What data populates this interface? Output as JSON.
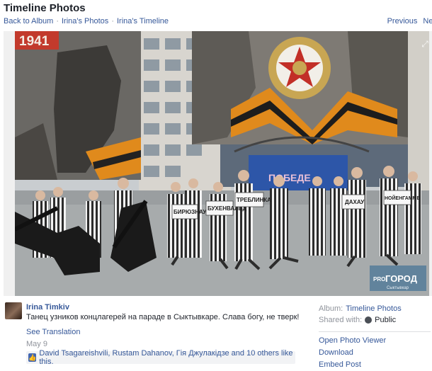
{
  "header": {
    "title": "Timeline Photos",
    "breadcrumbs": [
      "Back to Album",
      "Irina's Photos",
      "Irina's Timeline"
    ],
    "separator": "·",
    "prev_label": "Previous",
    "next_label": "Next"
  },
  "photo": {
    "year_text": "1941",
    "watermark_top": "PRO",
    "watermark_main": "ГОРОД",
    "watermark_sub": "Сыктывкар",
    "sign_labels": [
      "БИРЮЗНАУ",
      "БУХЕНВАЛЬД",
      "ТРЕБЛИНКА",
      "ДАХАУ",
      "НОЙЕНГАММЕ"
    ],
    "banner_text": "ПОБЕДЕ"
  },
  "post": {
    "author": "Irina Timkiv",
    "caption": "Танец узников концлагерей на параде в Сыктывкаре. Слава богу, не тверк!",
    "translate_label": "See Translation",
    "date": "May 9",
    "likes_text": "David Tsagareishvili, Rustam Dahanov, Гія Джулакідзе and 10 others like this."
  },
  "sidebar": {
    "album_label": "Album:",
    "album_value": "Timeline Photos",
    "shared_label": "Shared with:",
    "shared_value": "Public",
    "actions": [
      "Open Photo Viewer",
      "Download",
      "Embed Post"
    ]
  }
}
